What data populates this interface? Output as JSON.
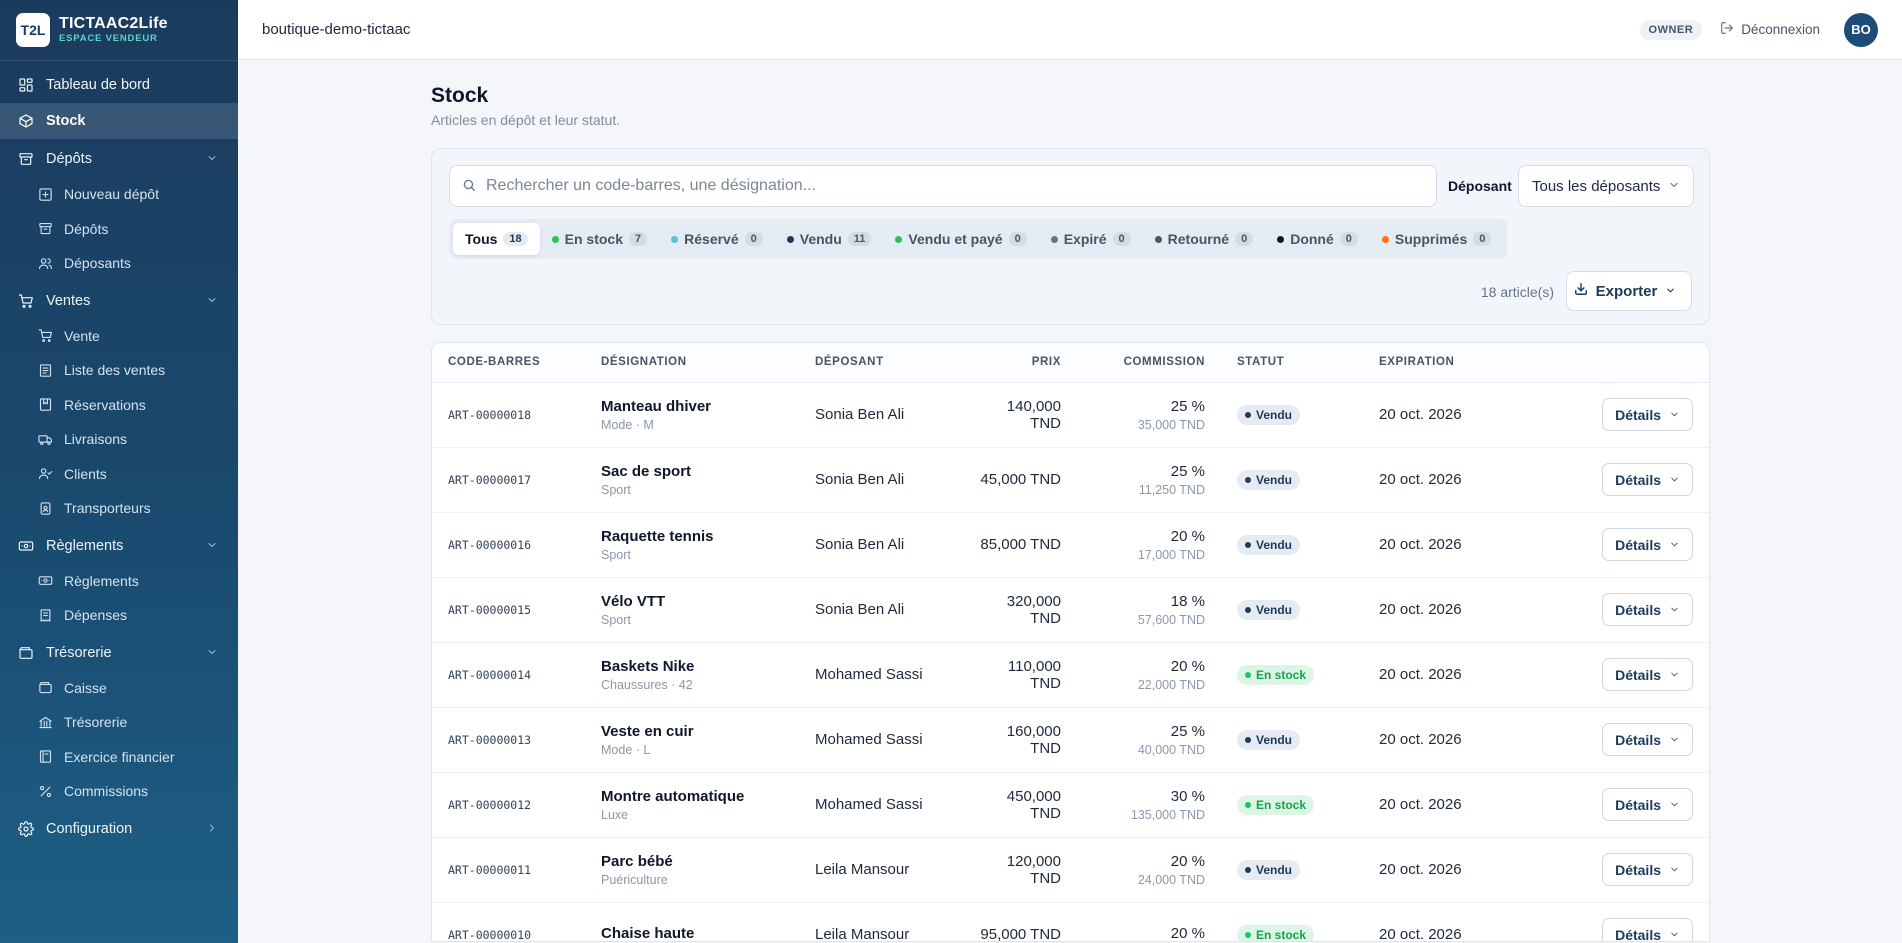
{
  "brand": {
    "logo": "T2L",
    "name": "TICTAAC2Life",
    "subtitle": "ESPACE VENDEUR"
  },
  "sidebar": {
    "items": [
      {
        "label": "Tableau de bord",
        "icon": "dashboard-icon"
      },
      {
        "label": "Stock",
        "icon": "box-icon",
        "active": true
      },
      {
        "label": "Dépôts",
        "icon": "archive-icon",
        "expanded": true,
        "children": [
          {
            "label": "Nouveau dépôt",
            "icon": "plus-square-icon"
          },
          {
            "label": "Dépôts",
            "icon": "archive-icon"
          },
          {
            "label": "Déposants",
            "icon": "users-icon"
          }
        ]
      },
      {
        "label": "Ventes",
        "icon": "cart-icon",
        "expanded": true,
        "children": [
          {
            "label": "Vente",
            "icon": "cart-icon"
          },
          {
            "label": "Liste des ventes",
            "icon": "list-icon"
          },
          {
            "label": "Réservations",
            "icon": "bookmark-icon"
          },
          {
            "label": "Livraisons",
            "icon": "truck-icon"
          },
          {
            "label": "Clients",
            "icon": "user-check-icon"
          },
          {
            "label": "Transporteurs",
            "icon": "id-badge-icon"
          }
        ]
      },
      {
        "label": "Règlements",
        "icon": "banknote-icon",
        "expanded": true,
        "children": [
          {
            "label": "Règlements",
            "icon": "banknote-icon"
          },
          {
            "label": "Dépenses",
            "icon": "receipt-icon"
          }
        ]
      },
      {
        "label": "Trésorerie",
        "icon": "wallet-icon",
        "expanded": true,
        "children": [
          {
            "label": "Caisse",
            "icon": "wallet-icon"
          },
          {
            "label": "Trésorerie",
            "icon": "bank-icon"
          },
          {
            "label": "Exercice financier",
            "icon": "calendar-book-icon"
          },
          {
            "label": "Commissions",
            "icon": "percent-icon"
          }
        ]
      },
      {
        "label": "Configuration",
        "icon": "gear-icon",
        "expanded": false
      }
    ]
  },
  "header": {
    "shop": "boutique-demo-tictaac",
    "role": "OWNER",
    "logout": "Déconnexion",
    "avatar": "BO"
  },
  "page": {
    "title": "Stock",
    "subtitle": "Articles en dépôt et leur statut."
  },
  "filters": {
    "search_placeholder": "Rechercher un code-barres, une désignation...",
    "depositor_label": "Déposant",
    "depositor_value": "Tous les déposants",
    "tabs": [
      {
        "label": "Tous",
        "count": "18",
        "active": true,
        "dot": ""
      },
      {
        "label": "En stock",
        "count": "7",
        "dot": "#22c55e"
      },
      {
        "label": "Réservé",
        "count": "0",
        "dot": "#5bc0d6"
      },
      {
        "label": "Vendu",
        "count": "11",
        "dot": "#1b3b5d"
      },
      {
        "label": "Vendu et payé",
        "count": "0",
        "dot": "#22c55e"
      },
      {
        "label": "Expiré",
        "count": "0",
        "dot": "#64748b"
      },
      {
        "label": "Retourné",
        "count": "0",
        "dot": "#475569"
      },
      {
        "label": "Donné",
        "count": "0",
        "dot": "#0f172a"
      },
      {
        "label": "Supprimés",
        "count": "0",
        "dot": "#f97316"
      }
    ],
    "count_label": "18 article(s)",
    "export_label": "Exporter"
  },
  "table": {
    "columns": [
      "CODE-BARRES",
      "DÉSIGNATION",
      "DÉPOSANT",
      "PRIX",
      "COMMISSION",
      "STATUT",
      "EXPIRATION"
    ],
    "rows": [
      {
        "barcode": "ART-00000018",
        "name": "Manteau dhiver",
        "category": "Mode · M",
        "depositor": "Sonia Ben Ali",
        "price": "140,000 TND",
        "pct": "25 %",
        "amount": "35,000 TND",
        "status": "Vendu",
        "status_kind": "sold",
        "expiration": "20 oct. 2026",
        "action": "Détails"
      },
      {
        "barcode": "ART-00000017",
        "name": "Sac de sport",
        "category": "Sport",
        "depositor": "Sonia Ben Ali",
        "price": "45,000 TND",
        "pct": "25 %",
        "amount": "11,250 TND",
        "status": "Vendu",
        "status_kind": "sold",
        "expiration": "20 oct. 2026",
        "action": "Détails"
      },
      {
        "barcode": "ART-00000016",
        "name": "Raquette tennis",
        "category": "Sport",
        "depositor": "Sonia Ben Ali",
        "price": "85,000 TND",
        "pct": "20 %",
        "amount": "17,000 TND",
        "status": "Vendu",
        "status_kind": "sold",
        "expiration": "20 oct. 2026",
        "action": "Détails"
      },
      {
        "barcode": "ART-00000015",
        "name": "Vélo VTT",
        "category": "Sport",
        "depositor": "Sonia Ben Ali",
        "price": "320,000 TND",
        "pct": "18 %",
        "amount": "57,600 TND",
        "status": "Vendu",
        "status_kind": "sold",
        "expiration": "20 oct. 2026",
        "action": "Détails"
      },
      {
        "barcode": "ART-00000014",
        "name": "Baskets Nike",
        "category": "Chaussures · 42",
        "depositor": "Mohamed Sassi",
        "price": "110,000 TND",
        "pct": "20 %",
        "amount": "22,000 TND",
        "status": "En stock",
        "status_kind": "instock",
        "expiration": "20 oct. 2026",
        "action": "Détails"
      },
      {
        "barcode": "ART-00000013",
        "name": "Veste en cuir",
        "category": "Mode · L",
        "depositor": "Mohamed Sassi",
        "price": "160,000 TND",
        "pct": "25 %",
        "amount": "40,000 TND",
        "status": "Vendu",
        "status_kind": "sold",
        "expiration": "20 oct. 2026",
        "action": "Détails"
      },
      {
        "barcode": "ART-00000012",
        "name": "Montre automatique",
        "category": "Luxe",
        "depositor": "Mohamed Sassi",
        "price": "450,000 TND",
        "pct": "30 %",
        "amount": "135,000 TND",
        "status": "En stock",
        "status_kind": "instock",
        "expiration": "20 oct. 2026",
        "action": "Détails"
      },
      {
        "barcode": "ART-00000011",
        "name": "Parc bébé",
        "category": "Puériculture",
        "depositor": "Leila Mansour",
        "price": "120,000 TND",
        "pct": "20 %",
        "amount": "24,000 TND",
        "status": "Vendu",
        "status_kind": "sold",
        "expiration": "20 oct. 2026",
        "action": "Détails"
      },
      {
        "barcode": "ART-00000010",
        "name": "Chaise haute",
        "category": "",
        "depositor": "Leila Mansour",
        "price": "95,000 TND",
        "pct": "20 %",
        "amount": "",
        "status": "En stock",
        "status_kind": "instock",
        "expiration": "20 oct. 2026",
        "action": "Détails"
      }
    ]
  }
}
